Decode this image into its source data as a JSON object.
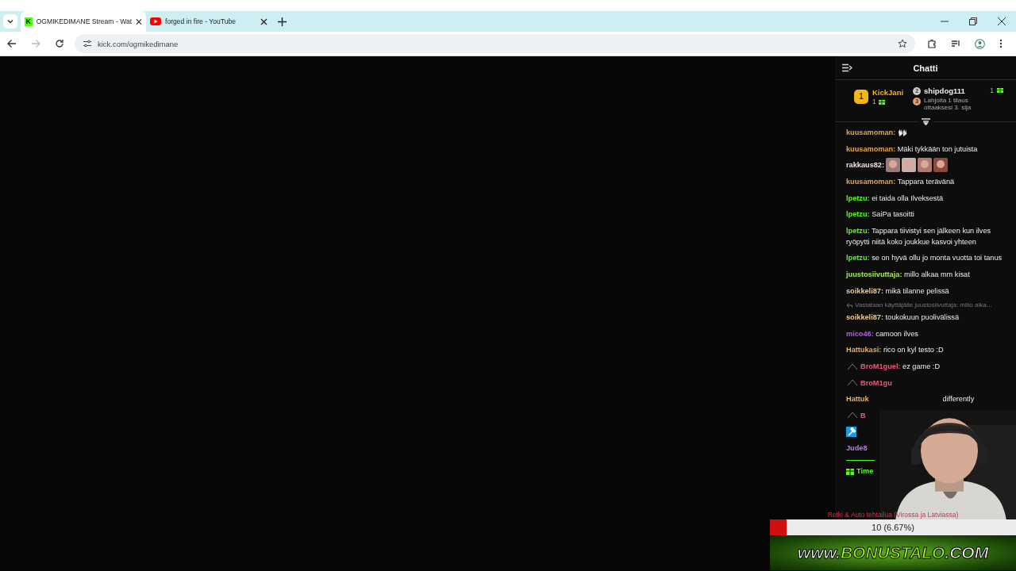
{
  "browser": {
    "tabs": [
      {
        "kind": "kick",
        "favicon": "K",
        "title": "OGMIKEDIMANE Stream - Wat",
        "selected": true
      },
      {
        "kind": "youtube",
        "title": "forged in fire - YouTube",
        "selected": false
      }
    ],
    "toolbar": {
      "url": "kick.com/ogmikedimane",
      "forward_disabled": true
    }
  },
  "chat": {
    "title": "Chatti",
    "leaders": [
      {
        "rank": "1",
        "name": "KickJani",
        "count": "1"
      },
      {
        "rank": "2",
        "name": "shipdog111",
        "count": "1"
      },
      {
        "rank": "3",
        "note": "Lahjoita 1 tilaus ottaaksesi 3. sija"
      }
    ],
    "messages": [
      {
        "kind": "emote",
        "user": "kuusamoman:",
        "color": "#e8a23c"
      },
      {
        "kind": "text",
        "user": "kuusamoman:",
        "color": "#e8a23c",
        "text": "Mäki tykkään ton jutuista"
      },
      {
        "kind": "faces",
        "user": "rakkaus82:",
        "color": "#f0dfe6"
      },
      {
        "kind": "text",
        "user": "kuusamoman:",
        "color": "#e8a23c",
        "text": "Tappara terävänä"
      },
      {
        "kind": "text",
        "user": "lpetzu:",
        "color": "#53fc18",
        "text": "ei taida olla Ilveksestä"
      },
      {
        "kind": "text",
        "user": "lpetzu:",
        "color": "#53fc18",
        "text": "SaiPa tasoitti"
      },
      {
        "kind": "text",
        "user": "lpetzu:",
        "color": "#53fc18",
        "text": "Tappara tiivistyi sen jälkeen kun ilves ryöpytti niitä koko joukkue kasvoi yhteen"
      },
      {
        "kind": "text",
        "user": "lpetzu:",
        "color": "#53fc18",
        "text": "se on hyvä ollu jo monta vuotta toi tanus"
      },
      {
        "kind": "text",
        "user": "juustosiivuttaja:",
        "color": "#a6e85a",
        "text": "millo alkaa mm kisat"
      },
      {
        "kind": "text",
        "user": "soikkeli87:",
        "color": "#f2c98a",
        "text": "mikä tilanne pelissä"
      },
      {
        "kind": "text",
        "user": "soikkeli87:",
        "color": "#f2c98a",
        "text": "toukokuun puolivälissä",
        "reply": "Vastataan käyttäjälle juustosiivuttaja: millo alka..."
      },
      {
        "kind": "text",
        "user": "mico46:",
        "color": "#b45ce8",
        "text": "camoon ilves"
      },
      {
        "kind": "text",
        "user": "Hattukasi:",
        "color": "#e8b04c",
        "text": "rico on kyl testo :D"
      },
      {
        "kind": "text",
        "user": "BroM1guel:",
        "color": "#e85a7a",
        "text": "ez game :D",
        "badge": true
      },
      {
        "kind": "cut",
        "user": "BroM1gu",
        "color": "#e85a7a",
        "badge": true
      },
      {
        "kind": "cut",
        "user": "Hattuk",
        "color": "#e8b04c",
        "text": "differently"
      },
      {
        "kind": "cut",
        "user": "B",
        "color": "#e85a7a",
        "badge": true
      },
      {
        "kind": "tool"
      },
      {
        "kind": "cut",
        "user": "Jude8",
        "color": "#b87ce8"
      },
      {
        "kind": "gift",
        "user": "Time",
        "color": "#53fc18"
      }
    ]
  },
  "goal": {
    "label": "Retki & Auto tehtailua (Virossa ja Latviassa)",
    "level": 0.0667,
    "reading": "10 (6.67%)"
  },
  "banner": {
    "parts": [
      "www.",
      "BONUSTALO",
      ".COM"
    ]
  }
}
